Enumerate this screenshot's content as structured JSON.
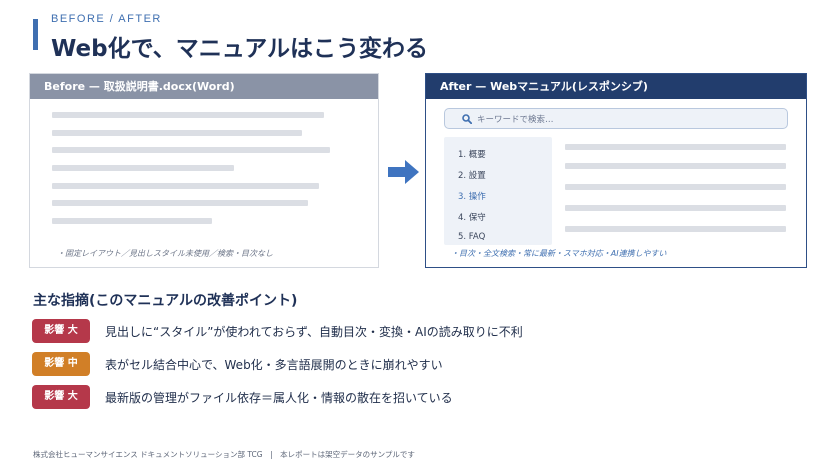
{
  "header": {
    "eyebrow": "BEFORE / AFTER",
    "title": "Web化で、マニュアルはこう変わる"
  },
  "before": {
    "label": "Before — 取扱説明書.docx(Word)",
    "note": "・固定レイアウト／見出しスタイル未使用／検索・目次なし"
  },
  "after": {
    "label": "After — Webマニュアル(レスポンシブ)",
    "search_placeholder": "キーワードで検索…",
    "toc": [
      {
        "label": "1. 概要",
        "active": false
      },
      {
        "label": "2. 設置",
        "active": false
      },
      {
        "label": "3. 操作",
        "active": true
      },
      {
        "label": "4. 保守",
        "active": false
      },
      {
        "label": "5. FAQ",
        "active": false
      }
    ],
    "note": "・目次・全文検索・常に最新・スマホ対応・AI連携しやすい"
  },
  "findings": {
    "title": "主な指摘(このマニュアルの改善ポイント)",
    "items": [
      {
        "badge": "影響 大",
        "text": "見出しに“スタイル”が使われておらず、自動目次・変換・AIの読み取りに不利",
        "color": "#b5384a"
      },
      {
        "badge": "影響 中",
        "text": "表がセル結合中心で、Web化・多言語展開のときに崩れやすい",
        "color": "#d17f27"
      },
      {
        "badge": "影響 大",
        "text": "最新版の管理がファイル依存＝属人化・情報の散在を招いている",
        "color": "#b5384a"
      }
    ]
  },
  "footer": {
    "text": "株式会社ヒューマンサイエンス ドキュメントソリューション部 TCG　|　本レポートは架空データのサンプルです"
  },
  "icons": {
    "search": "search-icon",
    "arrow": "arrow-right-icon"
  },
  "colors": {
    "accent": "#3f6fb0",
    "navy": "#223d6d",
    "before_header": "#8a93a6",
    "impact_high": "#b5384a",
    "impact_mid": "#d17f27"
  }
}
